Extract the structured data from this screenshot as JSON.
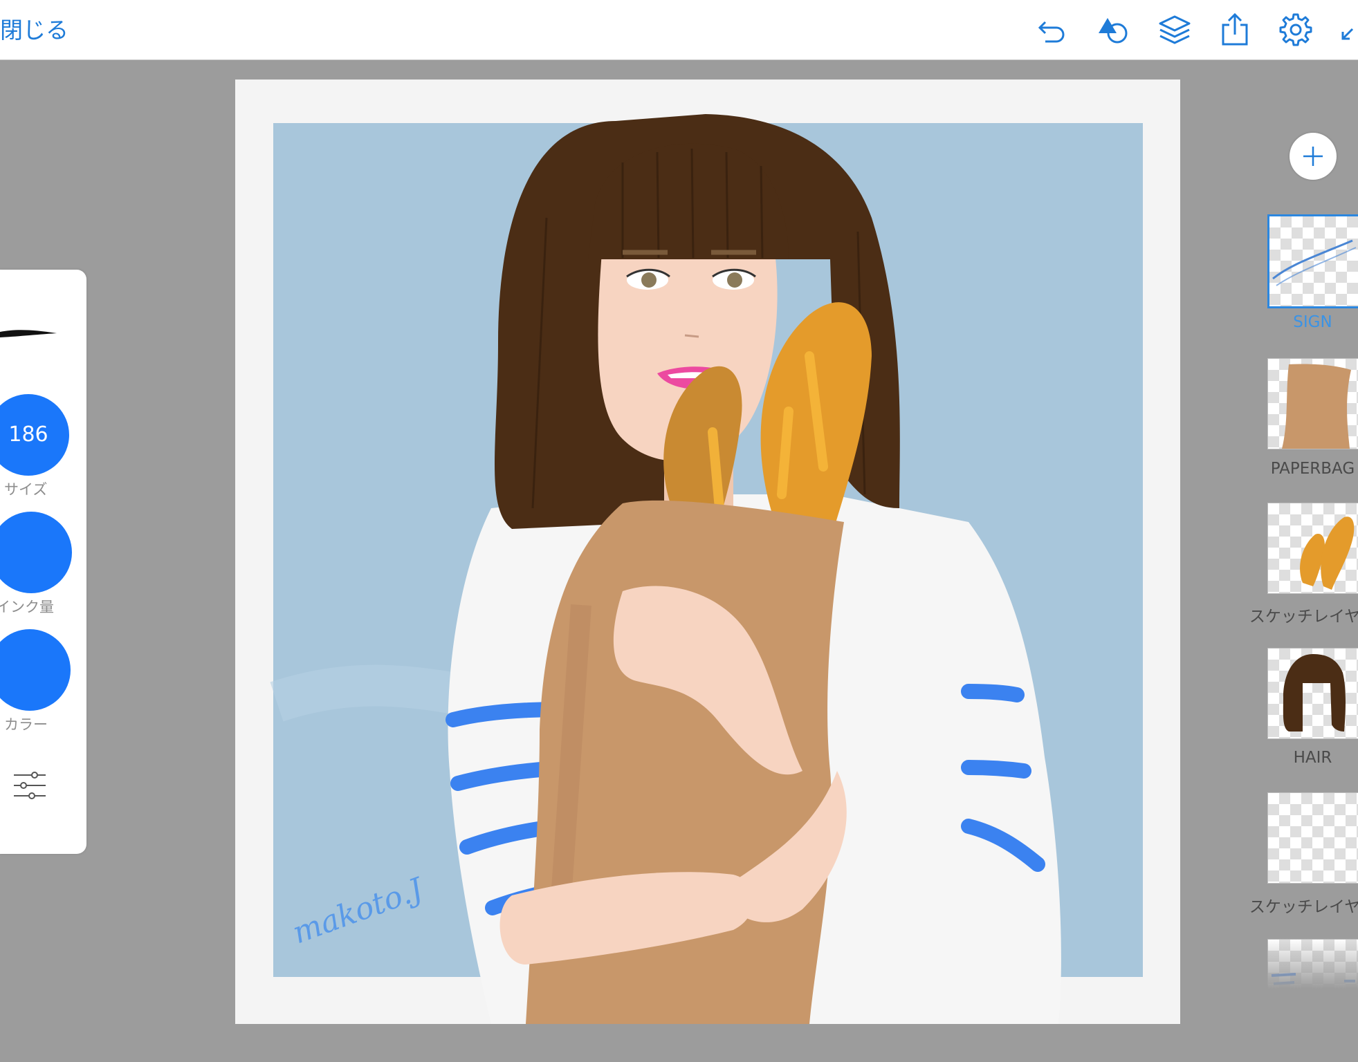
{
  "header": {
    "close_label": "閉じる",
    "icons": {
      "undo": "undo-icon",
      "shapes": "shapes-icon",
      "layers": "layers-icon",
      "share": "share-icon",
      "settings": "gear-icon",
      "collapse": "collapse-icon"
    }
  },
  "brush_panel": {
    "size_value": "186",
    "size_label": "サイズ",
    "ink_label": "インク量",
    "color_label": "カラー",
    "accent_color": "#1a77fa"
  },
  "artwork": {
    "signature": "makoto.J"
  },
  "layers": {
    "add_icon": "plus-icon",
    "items": [
      {
        "label": "SIGN",
        "selected": true
      },
      {
        "label": "PAPERBAG",
        "selected": false
      },
      {
        "label": "スケッチレイヤー",
        "selected": false
      },
      {
        "label": "HAIR",
        "selected": false
      },
      {
        "label": "スケッチレイヤー",
        "selected": false
      }
    ]
  }
}
